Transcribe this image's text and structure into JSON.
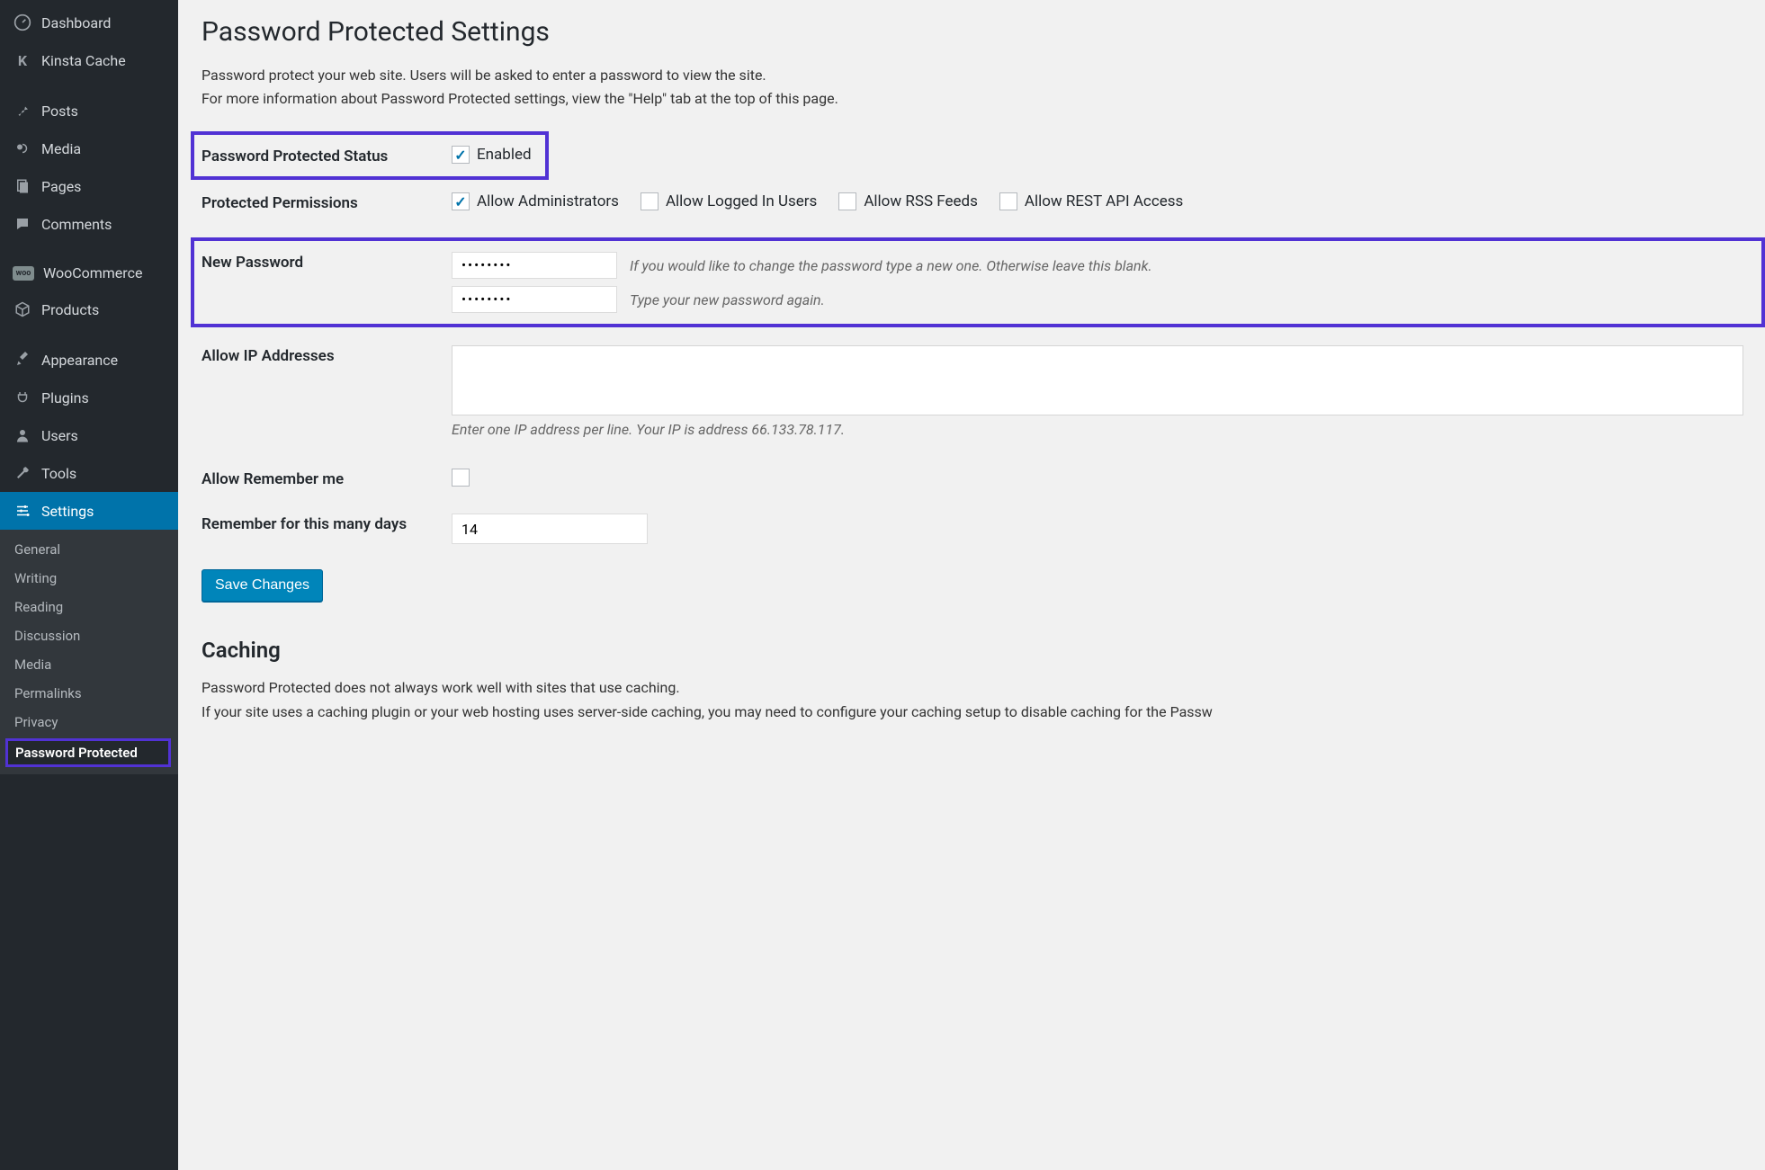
{
  "sidebar": {
    "items": [
      {
        "icon": "dashboard",
        "label": "Dashboard"
      },
      {
        "icon": "kinsta",
        "label": "Kinsta Cache"
      }
    ],
    "items2": [
      {
        "icon": "pin",
        "label": "Posts"
      },
      {
        "icon": "media",
        "label": "Media"
      },
      {
        "icon": "pages",
        "label": "Pages"
      },
      {
        "icon": "comments",
        "label": "Comments"
      }
    ],
    "items3": [
      {
        "icon": "woo",
        "label": "WooCommerce"
      },
      {
        "icon": "products",
        "label": "Products"
      }
    ],
    "items4": [
      {
        "icon": "appearance",
        "label": "Appearance"
      },
      {
        "icon": "plugins",
        "label": "Plugins"
      },
      {
        "icon": "users",
        "label": "Users"
      },
      {
        "icon": "tools",
        "label": "Tools"
      },
      {
        "icon": "settings",
        "label": "Settings"
      }
    ],
    "subitems": [
      "General",
      "Writing",
      "Reading",
      "Discussion",
      "Media",
      "Permalinks",
      "Privacy",
      "Password Protected"
    ]
  },
  "page": {
    "title": "Password Protected Settings",
    "desc1": "Password protect your web site. Users will be asked to enter a password to view the site.",
    "desc2": "For more information about Password Protected settings, view the \"Help\" tab at the top of this page.",
    "status_label": "Password Protected Status",
    "enabled_label": "Enabled",
    "perm_label": "Protected Permissions",
    "perm_admins": "Allow Administrators",
    "perm_logged": "Allow Logged In Users",
    "perm_rss": "Allow RSS Feeds",
    "perm_rest": "Allow REST API Access",
    "newpw_label": "New Password",
    "pw_hint1": "If you would like to change the password type a new one. Otherwise leave this blank.",
    "pw_hint2": "Type your new password again.",
    "allowip_label": "Allow IP Addresses",
    "ip_hint": "Enter one IP address per line. Your IP is address 66.133.78.117.",
    "remember_label": "Allow Remember me",
    "remember_days_label": "Remember for this many days",
    "remember_days_value": "14",
    "save_button": "Save Changes",
    "caching_title": "Caching",
    "caching_body1": "Password Protected does not always work well with sites that use caching.",
    "caching_body2": "If your site uses a caching plugin or your web hosting uses server-side caching, you may need to configure your caching setup to disable caching for the Passw"
  }
}
